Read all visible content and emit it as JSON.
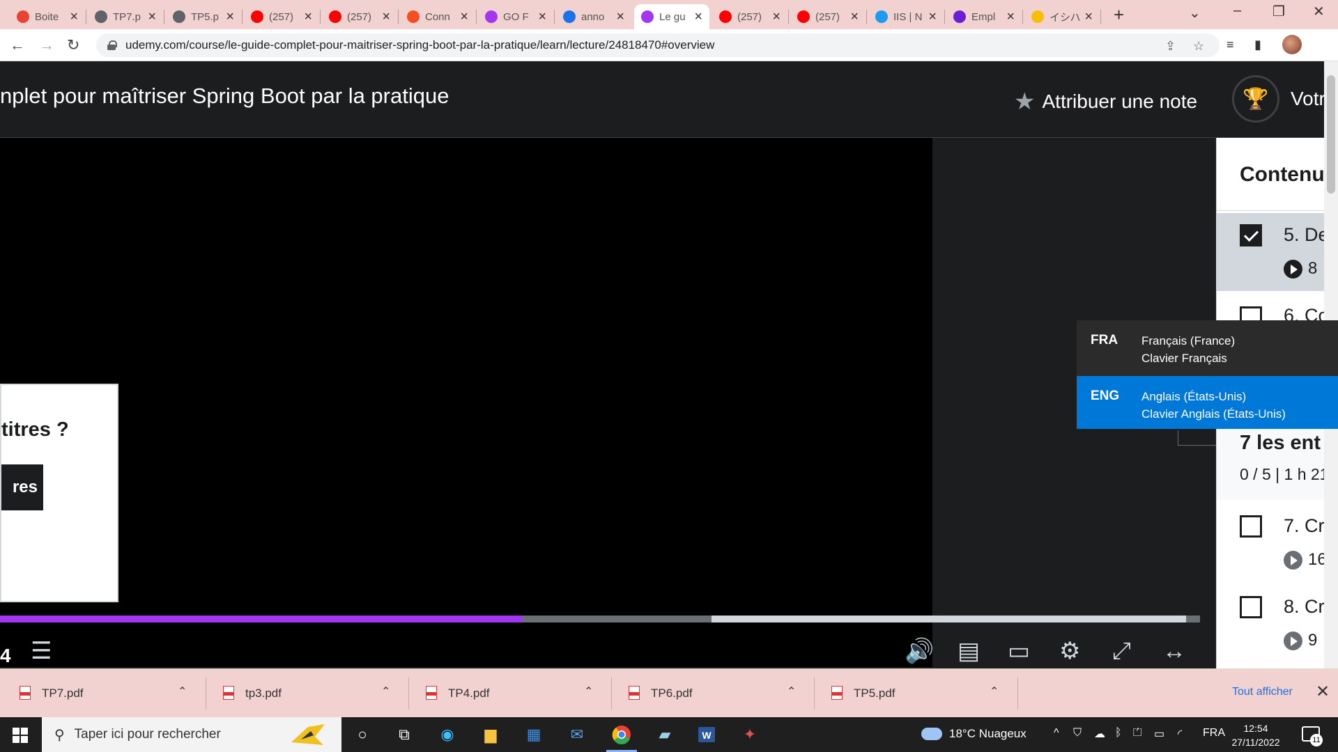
{
  "browser": {
    "tabs": [
      {
        "title": "Boite",
        "icon": "gmail-icon",
        "color": "#ea4335"
      },
      {
        "title": "TP7.p",
        "icon": "globe-icon",
        "color": "#5f6368"
      },
      {
        "title": "TP5.p",
        "icon": "globe-icon",
        "color": "#5f6368"
      },
      {
        "title": "(257)",
        "icon": "youtube-icon",
        "color": "#ff0000"
      },
      {
        "title": "(257)",
        "icon": "youtube-icon",
        "color": "#ff0000"
      },
      {
        "title": "Conn",
        "icon": "microsoft-icon",
        "color": "#f25022"
      },
      {
        "title": "GO F",
        "icon": "udemy-icon",
        "color": "#a435f0"
      },
      {
        "title": "anno",
        "icon": "shield-icon",
        "color": "#1a73e8"
      },
      {
        "title": "Le gu",
        "icon": "udemy-icon",
        "color": "#a435f0",
        "active": true
      },
      {
        "title": "(257)",
        "icon": "youtube-icon",
        "color": "#ff0000"
      },
      {
        "title": "(257)",
        "icon": "youtube-icon",
        "color": "#ff0000"
      },
      {
        "title": "IIS | N",
        "icon": "check-badge-icon",
        "color": "#1d9bf0"
      },
      {
        "title": "Empl",
        "icon": "app-icon",
        "color": "#6a1fd6"
      },
      {
        "title": "イシハ",
        "icon": "drive-icon",
        "color": "#fbbc04"
      }
    ],
    "url": "udemy.com/course/le-guide-complet-pour-maitriser-spring-boot-par-la-pratique/learn/lecture/24818470#overview"
  },
  "course": {
    "title": "nplet pour maîtriser Spring Boot par la pratique",
    "rate_label": "Attribuer une note",
    "progress_label": "Votr"
  },
  "video": {
    "popup_question": "titres ?",
    "popup_button": "res",
    "time_fragment": "4",
    "played_fraction": 0.435,
    "buffered_start_fraction": 0.593
  },
  "sidebar": {
    "title": "Contenu",
    "lectures": [
      {
        "title": "5. De",
        "meta": "8",
        "done": true
      },
      {
        "title": "6. Co",
        "meta": "",
        "done": false
      },
      {
        "title": "7. Cr",
        "meta": "16",
        "done": false
      },
      {
        "title": "8. Cr",
        "meta": "9",
        "done": false
      }
    ],
    "section_title": "7 les ent",
    "section_meta": "0 / 5 | 1 h 21"
  },
  "language_flyout": [
    {
      "code": "FRA",
      "line1": "Français (France)",
      "line2": "Clavier Français",
      "selected": false
    },
    {
      "code": "ENG",
      "line1": "Anglais (États-Unis)",
      "line2": "Clavier Anglais (États-Unis)",
      "selected": true
    }
  ],
  "downloads": {
    "files": [
      "TP7.pdf",
      "tp3.pdf",
      "TP4.pdf",
      "TP6.pdf",
      "TP5.pdf"
    ],
    "show_all": "Tout afficher"
  },
  "taskbar": {
    "search_placeholder": "Taper ici pour rechercher",
    "weather": "18°C  Nuageux",
    "lang": "FRA",
    "time": "12:54",
    "date": "27/11/2022",
    "notifications": "11"
  }
}
